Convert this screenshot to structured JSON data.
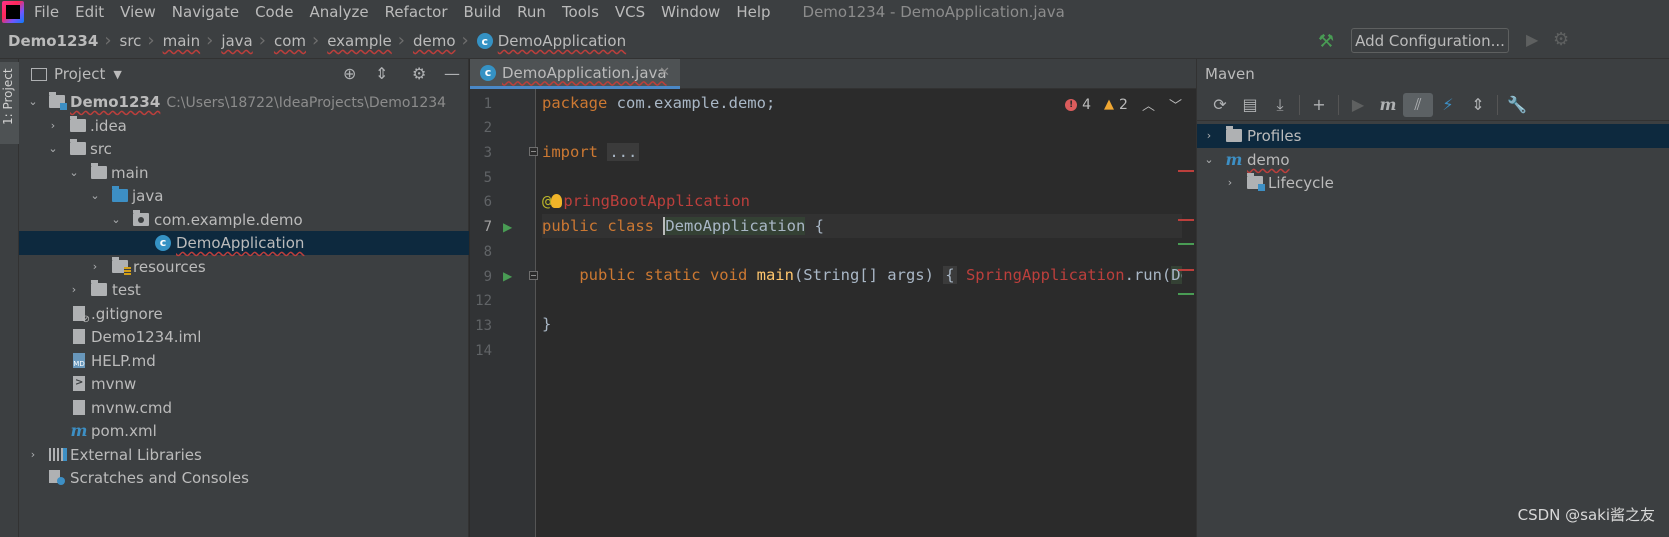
{
  "window": {
    "title": "Demo1234 - DemoApplication.java"
  },
  "menu": [
    {
      "label": "File"
    },
    {
      "label": "Edit"
    },
    {
      "label": "View"
    },
    {
      "label": "Navigate"
    },
    {
      "label": "Code"
    },
    {
      "label": "Analyze"
    },
    {
      "label": "Refactor"
    },
    {
      "label": "Build"
    },
    {
      "label": "Run"
    },
    {
      "label": "Tools"
    },
    {
      "label": "VCS"
    },
    {
      "label": "Window"
    },
    {
      "label": "Help"
    }
  ],
  "breadcrumb": [
    "Demo1234",
    "src",
    "main",
    "java",
    "com",
    "example",
    "demo",
    "DemoApplication"
  ],
  "toolbar": {
    "add_configuration": "Add Configuration..."
  },
  "left_strip": {
    "project_tab": "1: Project"
  },
  "project_panel": {
    "title": "Project",
    "tree": [
      {
        "label": "Demo1234",
        "path": "C:\\Users\\18722\\IdeaProjects\\Demo1234"
      },
      {
        "label": ".idea"
      },
      {
        "label": "src"
      },
      {
        "label": "main"
      },
      {
        "label": "java"
      },
      {
        "label": "com.example.demo"
      },
      {
        "label": "DemoApplication"
      },
      {
        "label": "resources"
      },
      {
        "label": "test"
      },
      {
        "label": ".gitignore"
      },
      {
        "label": "Demo1234.iml"
      },
      {
        "label": "HELP.md"
      },
      {
        "label": "mvnw"
      },
      {
        "label": "mvnw.cmd"
      },
      {
        "label": "pom.xml"
      },
      {
        "label": "External Libraries"
      },
      {
        "label": "Scratches and Consoles"
      }
    ]
  },
  "editor": {
    "tab_label": "DemoApplication.java",
    "line_numbers": [
      "1",
      "2",
      "3",
      "5",
      "6",
      "7",
      "8",
      "9",
      "12",
      "13",
      "14"
    ],
    "current_line": "7",
    "inspections": {
      "errors": "4",
      "warnings": "2"
    },
    "code": {
      "l1_kw": "package",
      "l1_rest": " com.example.demo;",
      "l3_kw": "import",
      "l3_fold": "...",
      "l6_at": "@",
      "l6_ann": "pringBootApplication",
      "l7_kw": "public class ",
      "l7_name": "DemoApplication",
      "l7_rest": " {",
      "l9_kw": "    public static void ",
      "l9_method": "main",
      "l9_args": "(String[] args) ",
      "l9_fold": "{",
      "l9_call": " SpringApplication",
      "l9_rest": ".run(",
      "l9_tail": "Dem",
      "l13": "}"
    }
  },
  "maven_panel": {
    "title": "Maven",
    "tree": [
      {
        "label": "Profiles"
      },
      {
        "label": "demo"
      },
      {
        "label": "Lifecycle"
      }
    ]
  },
  "watermark": "CSDN @saki酱之友"
}
